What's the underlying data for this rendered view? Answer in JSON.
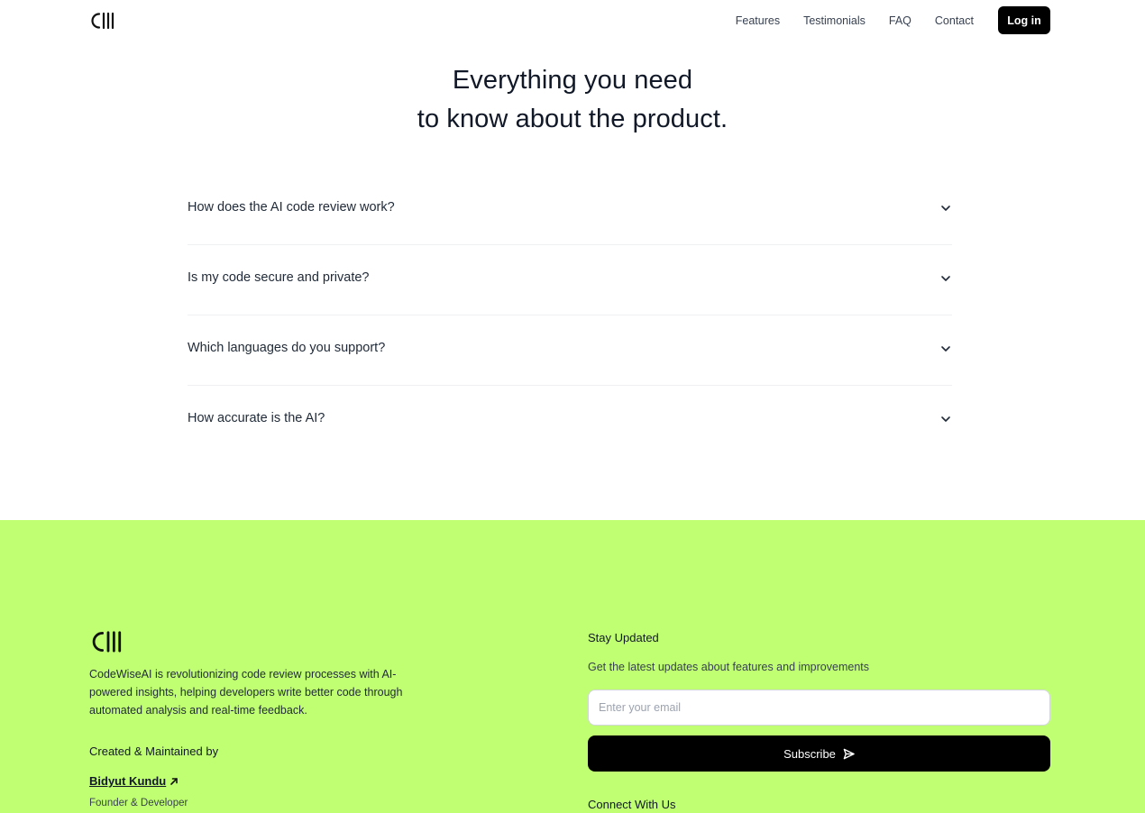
{
  "header": {
    "logo_icon": "cw-logo-icon",
    "nav": [
      {
        "label": "Features"
      },
      {
        "label": "Testimonials"
      },
      {
        "label": "FAQ"
      },
      {
        "label": "Contact"
      }
    ],
    "login_label": "Log in"
  },
  "faq": {
    "heading_line1": "Everything you need",
    "heading_line2": "to know about the product.",
    "items": [
      {
        "question": "How does the AI code review work?",
        "icon": "chevron-down-icon"
      },
      {
        "question": "Is my code secure and private?",
        "icon": "chevron-down-icon"
      },
      {
        "question": "Which languages do you support?",
        "icon": "chevron-down-icon"
      },
      {
        "question": "How accurate is the AI?",
        "icon": "chevron-down-icon"
      }
    ]
  },
  "footer": {
    "background_color": "#c1ff72",
    "description": "CodeWiseAI is revolutionizing code review processes with AI-powered insights, helping developers write better code through automated analysis and real-time feedback.",
    "created_label": "Created & Maintained by",
    "author_name": "Bidyut Kundu",
    "author_role": "Founder & Developer",
    "stay_updated": "Stay Updated",
    "latest_updates": "Get the latest updates about features and improvements",
    "email_placeholder": "Enter your email",
    "subscribe_label": "Subscribe",
    "connect_label": "Connect With Us"
  }
}
